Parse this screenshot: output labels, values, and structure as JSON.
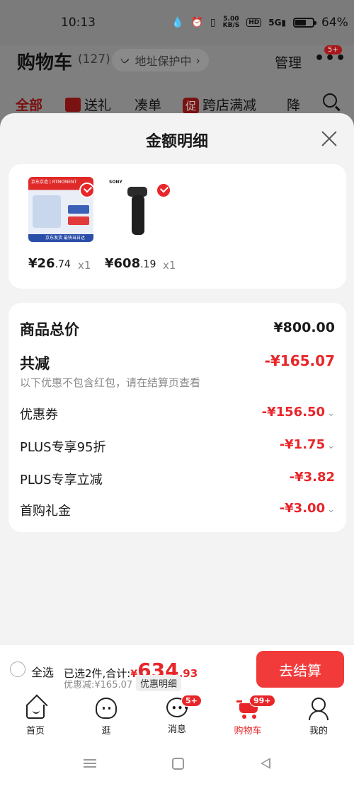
{
  "status_bar": {
    "time": "10:13",
    "network_speed_value": "5.00",
    "network_speed_unit": "KB/S",
    "hd_label": "HD",
    "signal_label": "5G",
    "battery_percent": "64%",
    "battery_level": 0.64
  },
  "cart_header": {
    "title": "购物车",
    "count": "(127)",
    "address_label": "地址保护中",
    "manage_label": "管理",
    "more_badge": "5+"
  },
  "filter_tabs": [
    {
      "label": "全部",
      "active": true
    },
    {
      "label": "送礼",
      "icon": "gift-icon"
    },
    {
      "label": "凑单"
    },
    {
      "label": "跨店满减",
      "prefix": "促"
    },
    {
      "label": "降"
    }
  ],
  "sheet": {
    "title": "金额明细"
  },
  "products": [
    {
      "price_int": "¥26",
      "price_dec": ".74",
      "qty": "x1",
      "thumb_brand": "京东京造 | RTMOMENT",
      "thumb_bottom": "京东发货 最快当日达"
    },
    {
      "price_int": "¥608",
      "price_dec": ".19",
      "qty": "x1",
      "thumb_brand": "SONY"
    }
  ],
  "breakdown": {
    "goods_total_label": "商品总价",
    "goods_total_value": "¥800.00",
    "total_discount_label": "共减",
    "total_discount_value": "-¥165.07",
    "note": "以下优惠不包含红包，请在结算页查看",
    "items": [
      {
        "label": "优惠券",
        "value": "-¥156.50",
        "expandable": true
      },
      {
        "label": "PLUS专享95折",
        "value": "-¥1.75",
        "expandable": true
      },
      {
        "label": "PLUS专享立减",
        "value": "-¥3.82",
        "expandable": false
      },
      {
        "label": "首购礼金",
        "value": "-¥3.00",
        "expandable": true
      }
    ]
  },
  "checkout": {
    "select_all_label": "全选",
    "selected_info": "已选2件,合计:",
    "total_currency": "¥",
    "total_int": "634",
    "total_dec": ".93",
    "discount_text": "优惠减:¥165.07",
    "detail_label": "优惠明细",
    "checkout_label": "去结算"
  },
  "tab_bar": [
    {
      "label": "首页",
      "icon": "home-icon"
    },
    {
      "label": "逛",
      "icon": "browse-face-icon"
    },
    {
      "label": "消息",
      "icon": "message-icon",
      "badge": "5+"
    },
    {
      "label": "购物车",
      "icon": "cart-icon",
      "badge": "99+",
      "active": true
    },
    {
      "label": "我的",
      "icon": "profile-icon"
    }
  ],
  "colors": {
    "accent": "#e8262a",
    "checkout_button": "#f13a3a",
    "sheet_background": "#f3f3f3"
  }
}
